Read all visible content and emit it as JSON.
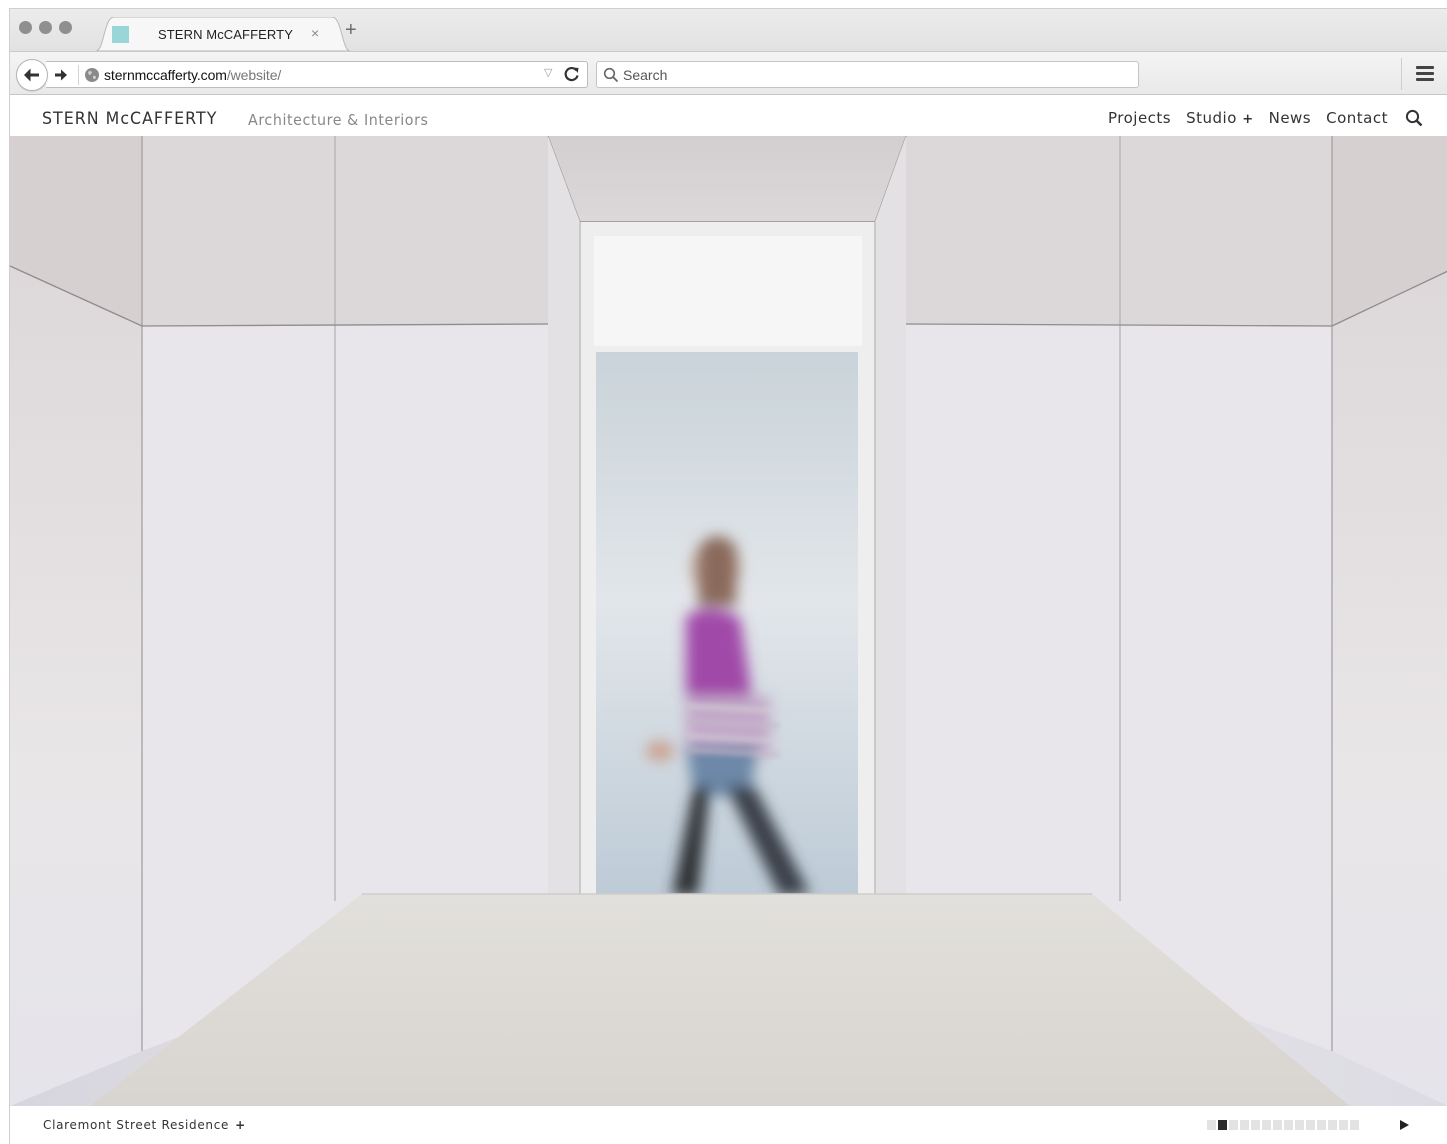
{
  "browser": {
    "tab_title": "STERN McCAFFERTY",
    "tab_close": "×",
    "new_tab": "+",
    "url_host": "sternmccafferty.com",
    "url_path": "/website/",
    "search_placeholder": "Search",
    "favicon_color": "#9ad6d8"
  },
  "site": {
    "brand": "STERN McCAFFERTY",
    "tagline": "Architecture & Interiors",
    "nav": {
      "projects": "Projects",
      "studio": "Studio",
      "studio_plus": "+",
      "news": "News",
      "contact": "Contact"
    }
  },
  "hero": {
    "subject": "blurred person walking through doorway in white-panelled room"
  },
  "footer": {
    "caption": "Claremont Street Residence",
    "caption_plus": "+",
    "slides_total": 14,
    "slides_active_index": 1
  },
  "icons": {
    "back": "back-arrow-icon",
    "forward": "forward-arrow-icon",
    "reload": "reload-icon",
    "search": "search-icon",
    "menu": "hamburger-icon",
    "play": "play-icon"
  }
}
